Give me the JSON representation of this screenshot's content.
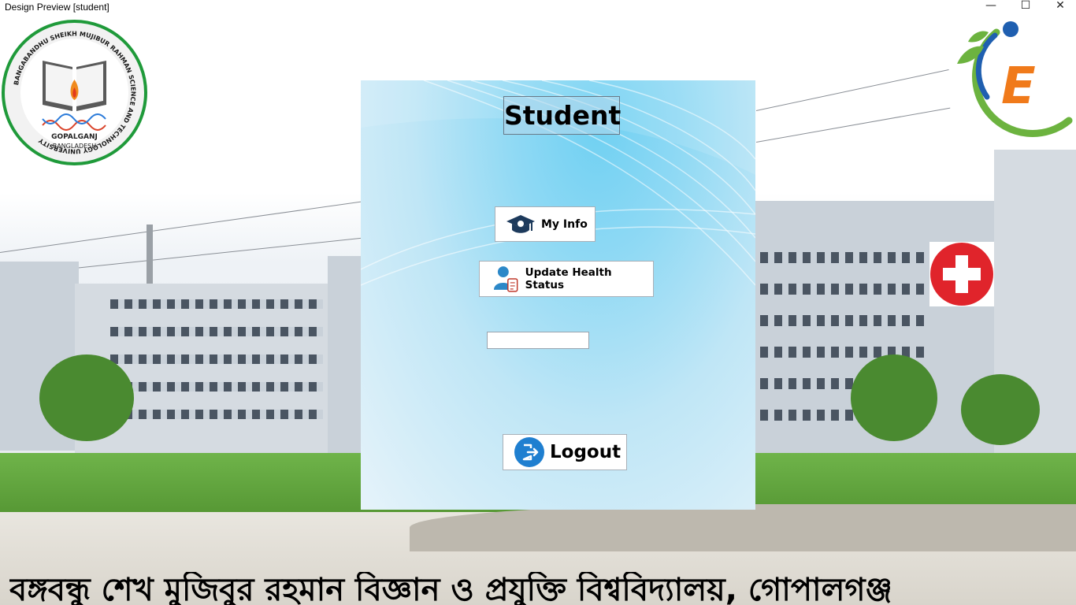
{
  "window": {
    "title": "Design Preview [student]",
    "controls": {
      "minimize": "—",
      "maximize": "☐",
      "close": "✕"
    }
  },
  "university_logo": {
    "ring_text": "BANGABANDHU SHEIKH MUJIBUR RAHMAN SCIENCE AND TECHNOLOGY UNIVERSITY",
    "city": "GOPALGANJ",
    "country": "BANGLADESH",
    "ring_color": "#1f9a3a"
  },
  "e_logo": {
    "letter": "E",
    "letter_color": "#f07a1a",
    "arc_color": "#6cb33f",
    "figure_color": "#1f5fb0"
  },
  "health_icon": {
    "icon": "red-cross-icon",
    "color": "#e0242b"
  },
  "panel": {
    "title": "Student",
    "buttons": {
      "my_info": "My Info",
      "update_health": "Update Health Status",
      "logout": "Logout"
    },
    "status_field": {
      "value": ""
    }
  },
  "footer": {
    "bangla_name": "বঙ্গবন্ধু শেখ মুজিবুর রহমান বিজ্ঞান ও প্রযুক্তি বিশ্ববিদ্যালয়, গোপালগঞ্জ"
  }
}
